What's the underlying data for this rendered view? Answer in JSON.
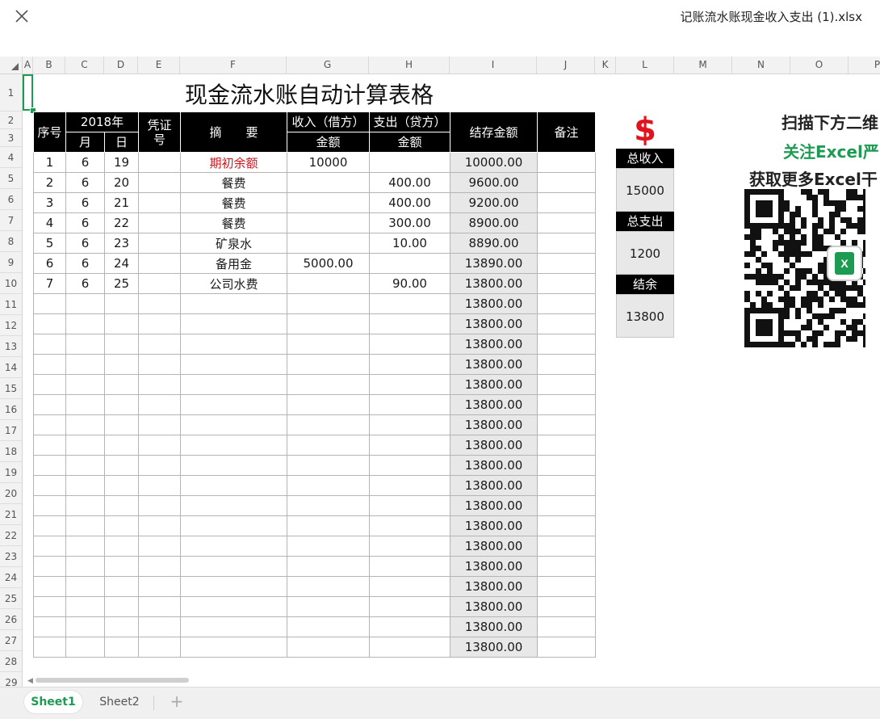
{
  "window": {
    "file_title": "记账流水账现金收入支出 (1).xlsx"
  },
  "grid": {
    "column_letters": [
      "A",
      "B",
      "C",
      "D",
      "E",
      "F",
      "G",
      "H",
      "I",
      "J",
      "K",
      "L",
      "M",
      "N",
      "O",
      "P"
    ],
    "row_numbers": [
      "1",
      "2",
      "3",
      "4",
      "5",
      "6",
      "7",
      "8",
      "9",
      "10",
      "11",
      "12",
      "13",
      "14",
      "15",
      "16",
      "17",
      "18",
      "19",
      "20",
      "21",
      "22",
      "23",
      "24",
      "25",
      "26",
      "27",
      "28"
    ],
    "last_row_number": "29"
  },
  "sheet": {
    "title": "现金流水账自动计算表格",
    "headers": {
      "seq": "序号",
      "year": "2018年",
      "month": "月",
      "day": "日",
      "voucher": "凭证号",
      "summary": "摘　　要",
      "income": "收入（借方）",
      "income_sub": "金额",
      "expense": "支出（贷方）",
      "expense_sub": "金额",
      "balance": "结存金额",
      "note": "备注"
    },
    "rows": [
      {
        "seq": "1",
        "month": "6",
        "day": "19",
        "voucher": "",
        "summary": "期初余额",
        "income": "10000",
        "expense": "",
        "balance": "10000.00",
        "note": ""
      },
      {
        "seq": "2",
        "month": "6",
        "day": "20",
        "voucher": "",
        "summary": "餐费",
        "income": "",
        "expense": "400.00",
        "balance": "9600.00",
        "note": ""
      },
      {
        "seq": "3",
        "month": "6",
        "day": "21",
        "voucher": "",
        "summary": "餐费",
        "income": "",
        "expense": "400.00",
        "balance": "9200.00",
        "note": ""
      },
      {
        "seq": "4",
        "month": "6",
        "day": "22",
        "voucher": "",
        "summary": "餐费",
        "income": "",
        "expense": "300.00",
        "balance": "8900.00",
        "note": ""
      },
      {
        "seq": "5",
        "month": "6",
        "day": "23",
        "voucher": "",
        "summary": "矿泉水",
        "income": "",
        "expense": "10.00",
        "balance": "8890.00",
        "note": ""
      },
      {
        "seq": "6",
        "month": "6",
        "day": "24",
        "voucher": "",
        "summary": "备用金",
        "income": "5000.00",
        "expense": "",
        "balance": "13890.00",
        "note": ""
      },
      {
        "seq": "7",
        "month": "6",
        "day": "25",
        "voucher": "",
        "summary": "公司水费",
        "income": "",
        "expense": "90.00",
        "balance": "13800.00",
        "note": ""
      },
      {
        "seq": "",
        "month": "",
        "day": "",
        "voucher": "",
        "summary": "",
        "income": "",
        "expense": "",
        "balance": "13800.00",
        "note": ""
      },
      {
        "seq": "",
        "month": "",
        "day": "",
        "voucher": "",
        "summary": "",
        "income": "",
        "expense": "",
        "balance": "13800.00",
        "note": ""
      },
      {
        "seq": "",
        "month": "",
        "day": "",
        "voucher": "",
        "summary": "",
        "income": "",
        "expense": "",
        "balance": "13800.00",
        "note": ""
      },
      {
        "seq": "",
        "month": "",
        "day": "",
        "voucher": "",
        "summary": "",
        "income": "",
        "expense": "",
        "balance": "13800.00",
        "note": ""
      },
      {
        "seq": "",
        "month": "",
        "day": "",
        "voucher": "",
        "summary": "",
        "income": "",
        "expense": "",
        "balance": "13800.00",
        "note": ""
      },
      {
        "seq": "",
        "month": "",
        "day": "",
        "voucher": "",
        "summary": "",
        "income": "",
        "expense": "",
        "balance": "13800.00",
        "note": ""
      },
      {
        "seq": "",
        "month": "",
        "day": "",
        "voucher": "",
        "summary": "",
        "income": "",
        "expense": "",
        "balance": "13800.00",
        "note": ""
      },
      {
        "seq": "",
        "month": "",
        "day": "",
        "voucher": "",
        "summary": "",
        "income": "",
        "expense": "",
        "balance": "13800.00",
        "note": ""
      },
      {
        "seq": "",
        "month": "",
        "day": "",
        "voucher": "",
        "summary": "",
        "income": "",
        "expense": "",
        "balance": "13800.00",
        "note": ""
      },
      {
        "seq": "",
        "month": "",
        "day": "",
        "voucher": "",
        "summary": "",
        "income": "",
        "expense": "",
        "balance": "13800.00",
        "note": ""
      },
      {
        "seq": "",
        "month": "",
        "day": "",
        "voucher": "",
        "summary": "",
        "income": "",
        "expense": "",
        "balance": "13800.00",
        "note": ""
      },
      {
        "seq": "",
        "month": "",
        "day": "",
        "voucher": "",
        "summary": "",
        "income": "",
        "expense": "",
        "balance": "13800.00",
        "note": ""
      },
      {
        "seq": "",
        "month": "",
        "day": "",
        "voucher": "",
        "summary": "",
        "income": "",
        "expense": "",
        "balance": "13800.00",
        "note": ""
      },
      {
        "seq": "",
        "month": "",
        "day": "",
        "voucher": "",
        "summary": "",
        "income": "",
        "expense": "",
        "balance": "13800.00",
        "note": ""
      },
      {
        "seq": "",
        "month": "",
        "day": "",
        "voucher": "",
        "summary": "",
        "income": "",
        "expense": "",
        "balance": "13800.00",
        "note": ""
      },
      {
        "seq": "",
        "month": "",
        "day": "",
        "voucher": "",
        "summary": "",
        "income": "",
        "expense": "",
        "balance": "13800.00",
        "note": ""
      },
      {
        "seq": "",
        "month": "",
        "day": "",
        "voucher": "",
        "summary": "",
        "income": "",
        "expense": "",
        "balance": "13800.00",
        "note": ""
      },
      {
        "seq": "",
        "month": "",
        "day": "",
        "voucher": "",
        "summary": "",
        "income": "",
        "expense": "",
        "balance": "13800.00",
        "note": ""
      }
    ],
    "summary_panel": {
      "currency_symbol": "$",
      "total_income_label": "总收入",
      "total_income_value": "15000",
      "total_expense_label": "总支出",
      "total_expense_value": "1200",
      "balance_label": "结余",
      "balance_value": "13800"
    },
    "promo": {
      "line1": "扫描下方二维",
      "line2": "关注Excel严",
      "line3": "获取更多Excel干"
    }
  },
  "tabs": [
    {
      "label": "Sheet1",
      "active": true
    },
    {
      "label": "Sheet2",
      "active": false
    }
  ],
  "colors": {
    "accent": "#1e9b52",
    "header_bg": "#000000",
    "opening_balance_text": "#d0121b",
    "dollar": "#e0141e",
    "promo_line1": "#222222",
    "promo_line2": "#1e9b52",
    "promo_line3": "#222222"
  },
  "icons": {
    "close": "close-icon",
    "select_all": "select-all-corner-icon",
    "qr": "qr-code-image",
    "excel": "excel-logo-icon",
    "add_sheet": "plus-icon"
  }
}
